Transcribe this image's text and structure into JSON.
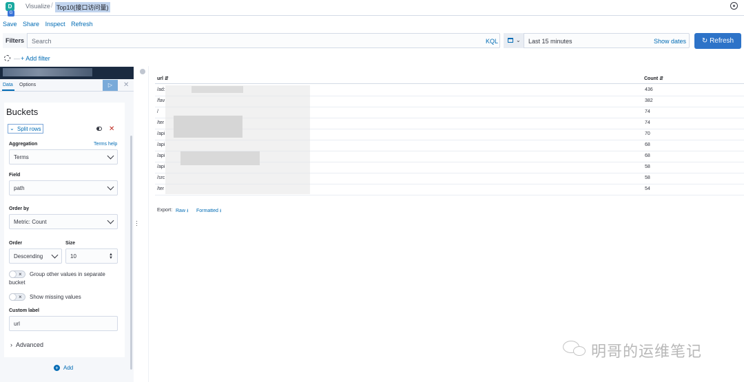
{
  "app": {
    "logo_letter": "D",
    "logo_sub": "G"
  },
  "breadcrumb": {
    "section": "Visualize",
    "title": "Top10(接口访问量)"
  },
  "topnav": [
    "Save",
    "Share",
    "Inspect",
    "Refresh"
  ],
  "query": {
    "filters_label": "Filters",
    "search_placeholder": "Search",
    "kql": "KQL"
  },
  "time": {
    "range": "Last 15 minutes",
    "show_dates": "Show dates",
    "refresh_label": "Refresh"
  },
  "filterbar": {
    "add_filter": "+ Add filter"
  },
  "editor": {
    "tabs": [
      "Data",
      "Options"
    ],
    "buckets_title": "Buckets",
    "split_rows": "Split rows",
    "aggregation_label": "Aggregation",
    "terms_help": "Terms help",
    "aggregation_value": "Terms",
    "field_label": "Field",
    "field_value": "path",
    "order_by_label": "Order by",
    "order_by_value": "Metric: Count",
    "order_label": "Order",
    "order_value": "Descending",
    "size_label": "Size",
    "size_value": "10",
    "group_other": "Group other values in separate",
    "group_other_2": "bucket",
    "show_missing": "Show missing values",
    "custom_label_label": "Custom label",
    "custom_label_value": "url",
    "advanced": "Advanced",
    "add": "Add"
  },
  "table": {
    "columns": [
      "url",
      "Count"
    ],
    "rows": [
      {
        "url": "/ad:",
        "count": "436"
      },
      {
        "url": "/fav",
        "count": "382"
      },
      {
        "url": "/",
        "count": "74"
      },
      {
        "url": "/ter",
        "count": "74"
      },
      {
        "url": "/api",
        "count": "70"
      },
      {
        "url": "/api",
        "count": "68"
      },
      {
        "url": "/api",
        "count": "68"
      },
      {
        "url": "/api",
        "count": "58"
      },
      {
        "url": "/src",
        "count": "58"
      },
      {
        "url": "/ter",
        "count": "54"
      }
    ],
    "export_label": "Export:",
    "raw": "Raw",
    "formatted": "Formatted"
  },
  "watermark": "明哥的运维笔记",
  "colors": {
    "primary": "#006bb4",
    "refresh_button": "#2d73c8",
    "danger": "#bd271e"
  }
}
